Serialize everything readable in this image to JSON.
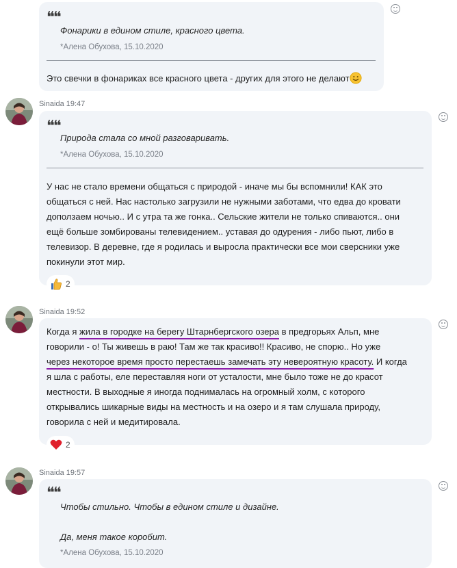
{
  "messages": [
    {
      "quote_text": "Фонарики в едином стиле, красного цвета.",
      "quote_meta": "*Алена Обухова, 15.10.2020",
      "body": "Это свечки в фонариках все красного цвета - других для этого не делают",
      "body_emoji": "smiling-face-emoji"
    },
    {
      "author": "Sinaida",
      "time": "19:47",
      "quote_text": "Природа стала со мной разговаривать.",
      "quote_meta": "*Алена Обухова, 15.10.2020",
      "body_lines": [
        "У нас не стало времени общаться с природой - иначе мы бы вспомнили! КАК это",
        "общаться с ней. Нас настолько загрузили не нужными заботами, что едва до кровати",
        "доползаем ночью.. И с утра та же гонка.. Сельские жители не только спиваются.. они",
        "ещё больше зомбированы телевидением.. уставая до одурения - либо пьют, либо в",
        "телевизор. В деревне, где я родилась и выросла практически все мои сверсники уже",
        "покинули этот мир."
      ],
      "reaction": {
        "icon": "thumbs-up-icon",
        "count": "2"
      }
    },
    {
      "author": "Sinaida",
      "time": "19:52",
      "body_parts": {
        "l1_a": "Когда я ",
        "l1_u": "жила в городке на берегу Штарнбергского озера",
        "l1_b": " в предгорьях Альп, мне",
        "l2": "говорили - о! Ты живешь в раю! Там же так красиво!! Красиво, не спорю.. Но уже",
        "l3_u": "через некоторое время просто перестаешь замечать эту невероятную красоту.",
        "l3_b": " И когда",
        "l4": "я шла с работы, еле переставляя ноги от усталости, мне было тоже не до красот",
        "l5": "местности. В выходные я иногда поднималась на огромный холм, с которого",
        "l6": "открывались шикарные виды на местность и на озеро и я там слушала природу,",
        "l7": "говорила с ней и медитировала."
      },
      "reaction": {
        "icon": "heart-icon",
        "count": "2"
      }
    },
    {
      "author": "Sinaida",
      "time": "19:57",
      "quote_text": "Чтобы стильно. Чтобы в едином стиле и дизайне.",
      "quote_text2": "Да, меня такое коробит.",
      "quote_meta": "*Алена Обухова, 15.10.2020"
    }
  ]
}
